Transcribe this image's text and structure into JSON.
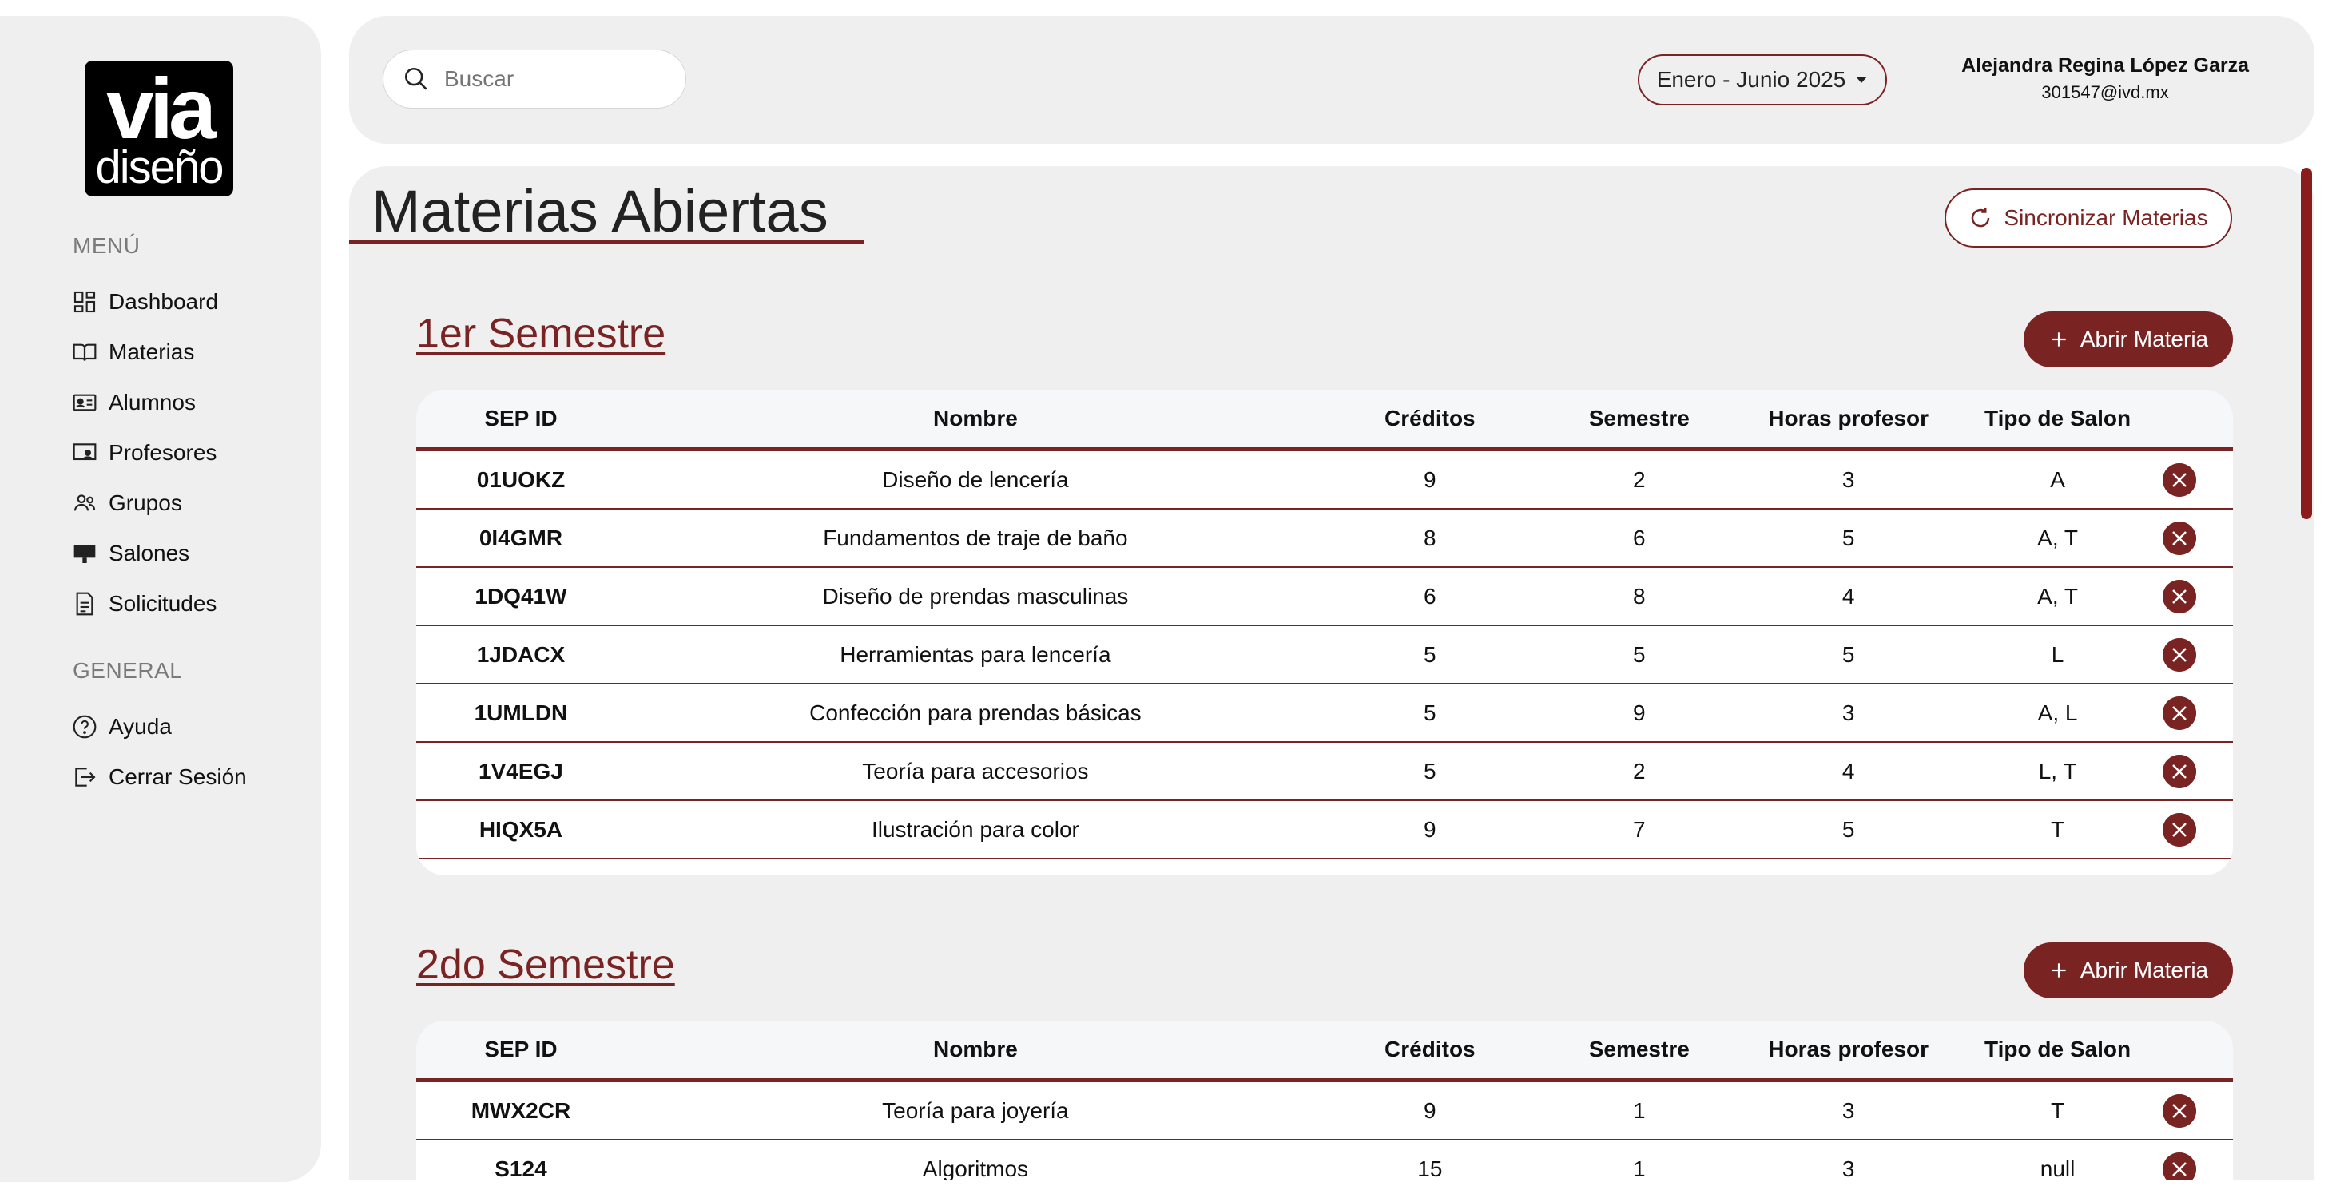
{
  "sidebar": {
    "logo_top": "via",
    "logo_bottom": "diseño",
    "menu_title": "MENÚ",
    "general_title": "GENERAL",
    "items": [
      {
        "label": "Dashboard",
        "icon": "dashboard-icon"
      },
      {
        "label": "Materias",
        "icon": "book-icon"
      },
      {
        "label": "Alumnos",
        "icon": "id-card-icon"
      },
      {
        "label": "Profesores",
        "icon": "teacher-icon"
      },
      {
        "label": "Grupos",
        "icon": "group-icon"
      },
      {
        "label": "Salones",
        "icon": "classroom-icon"
      },
      {
        "label": "Solicitudes",
        "icon": "document-icon"
      }
    ],
    "general": [
      {
        "label": "Ayuda",
        "icon": "help-icon"
      },
      {
        "label": "Cerrar Sesión",
        "icon": "logout-icon"
      }
    ]
  },
  "header": {
    "search_placeholder": "Buscar",
    "term": "Enero - Junio 2025",
    "user_name": "Alejandra Regina López Garza",
    "user_email": "301547@ivd.mx"
  },
  "main": {
    "title": "Materias Abiertas",
    "sync_label": "Sincronizar Materias",
    "open_label": "Abrir Materia",
    "columns": [
      "SEP ID",
      "Nombre",
      "Créditos",
      "Semestre",
      "Horas profesor",
      "Tipo de Salon"
    ],
    "semesters": [
      {
        "title": "1er Semestre",
        "rows": [
          [
            "01UOKZ",
            "Diseño de lencería",
            "9",
            "2",
            "3",
            "A"
          ],
          [
            "0I4GMR",
            "Fundamentos de traje de baño",
            "8",
            "6",
            "5",
            "A, T"
          ],
          [
            "1DQ41W",
            "Diseño de prendas masculinas",
            "6",
            "8",
            "4",
            "A, T"
          ],
          [
            "1JDACX",
            "Herramientas para lencería",
            "5",
            "5",
            "5",
            "L"
          ],
          [
            "1UMLDN",
            "Confección para prendas básicas",
            "5",
            "9",
            "3",
            "A, L"
          ],
          [
            "1V4EGJ",
            "Teoría para accesorios",
            "5",
            "2",
            "4",
            "L, T"
          ],
          [
            "HIQX5A",
            "Ilustración para color",
            "9",
            "7",
            "5",
            "T"
          ]
        ]
      },
      {
        "title": "2do Semestre",
        "rows": [
          [
            "MWX2CR",
            "Teoría para joyería",
            "9",
            "1",
            "3",
            "T"
          ],
          [
            "S124",
            "Algoritmos",
            "15",
            "1",
            "3",
            "null"
          ]
        ]
      }
    ]
  },
  "colors": {
    "accent": "#7a2323",
    "panel": "#efefef"
  }
}
